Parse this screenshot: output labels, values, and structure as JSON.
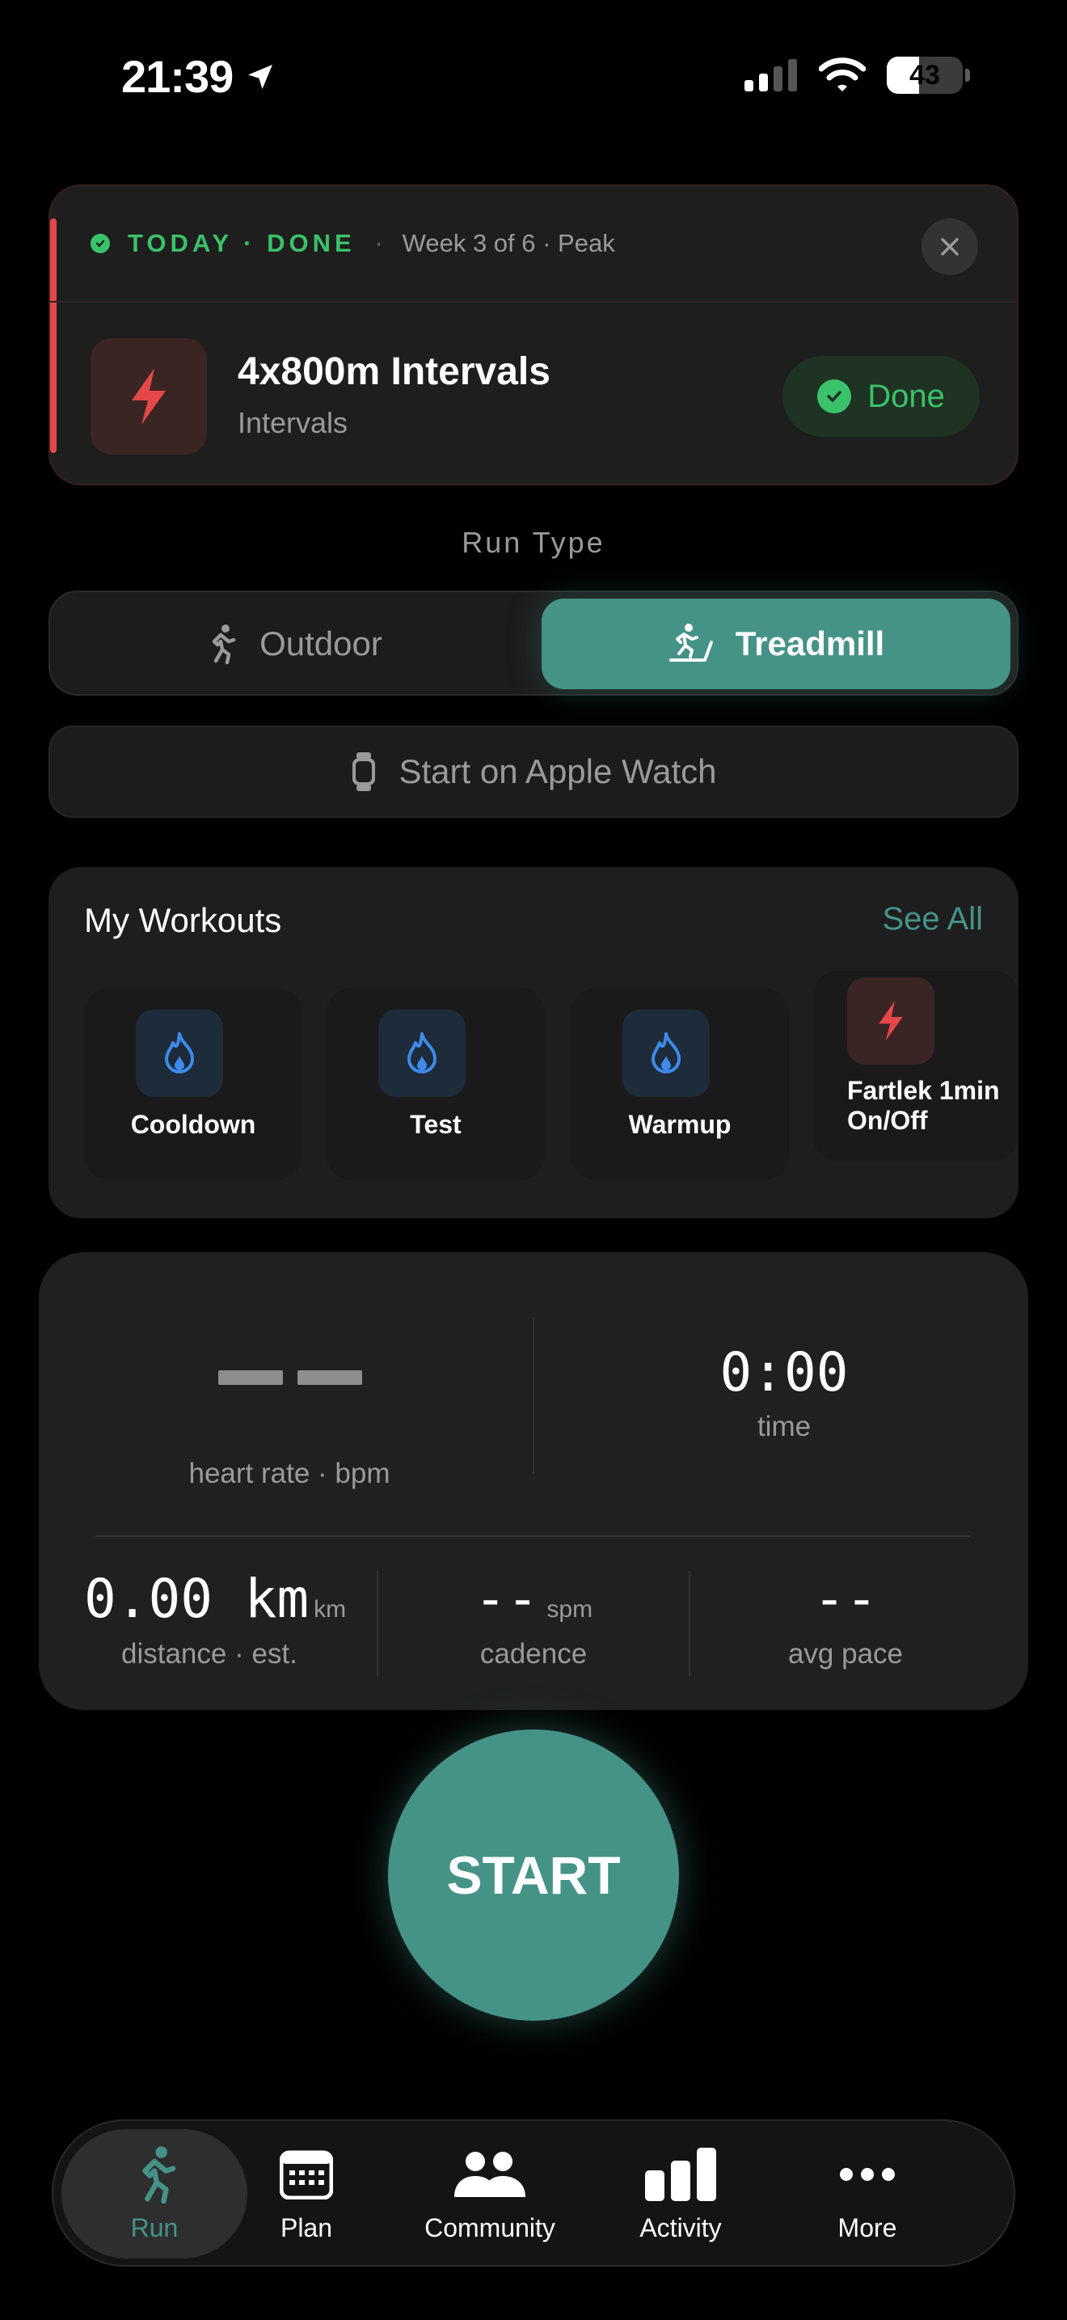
{
  "status_bar": {
    "time": "21:39",
    "battery": "43"
  },
  "today": {
    "label": "TODAY · DONE",
    "separator": "·",
    "week": "Week 3 of 6 · Peak",
    "workout_title": "4x800m Intervals",
    "workout_type": "Intervals",
    "done_label": "Done"
  },
  "run_type": {
    "label": "Run Type",
    "options": [
      "Outdoor",
      "Treadmill"
    ],
    "selected": "Treadmill"
  },
  "watch_button": "Start on Apple Watch",
  "my_workouts": {
    "title": "My Workouts",
    "see_all": "See All",
    "items": [
      {
        "label": "Cooldown",
        "icon": "flame-icon"
      },
      {
        "label": "Test",
        "icon": "flame-icon"
      },
      {
        "label": "Warmup",
        "icon": "flame-icon"
      },
      {
        "label": "Fartlek 1min On/Off",
        "label_line1": "Fartlek 1min",
        "label_line2": "On/Off",
        "icon": "bolt-icon"
      }
    ]
  },
  "stats": {
    "heart_rate_label": "heart rate · bpm",
    "time_value": "0:00",
    "time_label": "time",
    "distance_value": "0.00 km",
    "distance_unit": "km",
    "distance_label": "distance · est.",
    "cadence_value": "--",
    "cadence_unit": "spm",
    "cadence_label": "cadence",
    "pace_value": "--",
    "pace_label": "avg pace"
  },
  "start_label": "START",
  "tabs": [
    {
      "label": "Run",
      "icon": "runner-icon",
      "active": true
    },
    {
      "label": "Plan",
      "icon": "calendar-icon",
      "active": false
    },
    {
      "label": "Community",
      "icon": "people-icon",
      "active": false
    },
    {
      "label": "Activity",
      "icon": "bar-chart-icon",
      "active": false
    },
    {
      "label": "More",
      "icon": "ellipsis-icon",
      "active": false
    }
  ],
  "colors": {
    "accent": "#459387",
    "success": "#3ac26a",
    "danger": "#e54848"
  }
}
